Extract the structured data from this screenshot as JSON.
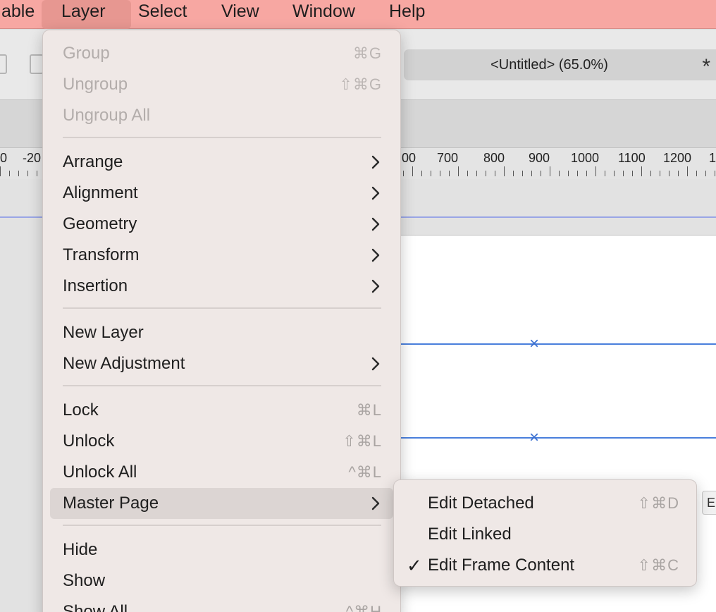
{
  "menubar": {
    "items": [
      {
        "label": "able"
      },
      {
        "label": "Layer"
      },
      {
        "label": "Select"
      },
      {
        "label": "View"
      },
      {
        "label": "Window"
      },
      {
        "label": "Help"
      }
    ]
  },
  "document": {
    "title": "<Untitled> (65.0%)",
    "dirty_mark": "*"
  },
  "ruler": {
    "labels": [
      "0",
      "-20",
      "00",
      "700",
      "800",
      "900",
      "1000",
      "1100",
      "1200",
      "1"
    ]
  },
  "edge_button": {
    "label": "E"
  },
  "layer_menu": {
    "items": [
      {
        "label": "Group",
        "shortcut": "⌘G",
        "disabled": true
      },
      {
        "label": "Ungroup",
        "shortcut": "⇧⌘G",
        "disabled": true
      },
      {
        "label": "Ungroup All",
        "shortcut": "",
        "disabled": true
      },
      {
        "label": "Arrange",
        "submenu": true
      },
      {
        "label": "Alignment",
        "submenu": true
      },
      {
        "label": "Geometry",
        "submenu": true
      },
      {
        "label": "Transform",
        "submenu": true
      },
      {
        "label": "Insertion",
        "submenu": true
      },
      {
        "label": "New Layer"
      },
      {
        "label": "New Adjustment",
        "submenu": true
      },
      {
        "label": "Lock",
        "shortcut": "⌘L"
      },
      {
        "label": "Unlock",
        "shortcut": "⇧⌘L"
      },
      {
        "label": "Unlock All",
        "shortcut": "^⌘L"
      },
      {
        "label": "Master Page",
        "submenu": true,
        "highlighted": true
      },
      {
        "label": "Hide"
      },
      {
        "label": "Show"
      },
      {
        "label": "Show All",
        "shortcut": "^⌘H"
      }
    ]
  },
  "master_page_submenu": {
    "items": [
      {
        "label": "Edit Detached",
        "shortcut": "⇧⌘D",
        "checked": false
      },
      {
        "label": "Edit Linked",
        "shortcut": "",
        "checked": false
      },
      {
        "label": "Edit Frame Content",
        "shortcut": "⇧⌘C",
        "checked": true,
        "check_glyph": "✓"
      }
    ]
  },
  "colors": {
    "menubar_bg": "#f7a7a2",
    "menu_bg": "#efe8e6",
    "guide_blue": "#4a7fdc"
  }
}
